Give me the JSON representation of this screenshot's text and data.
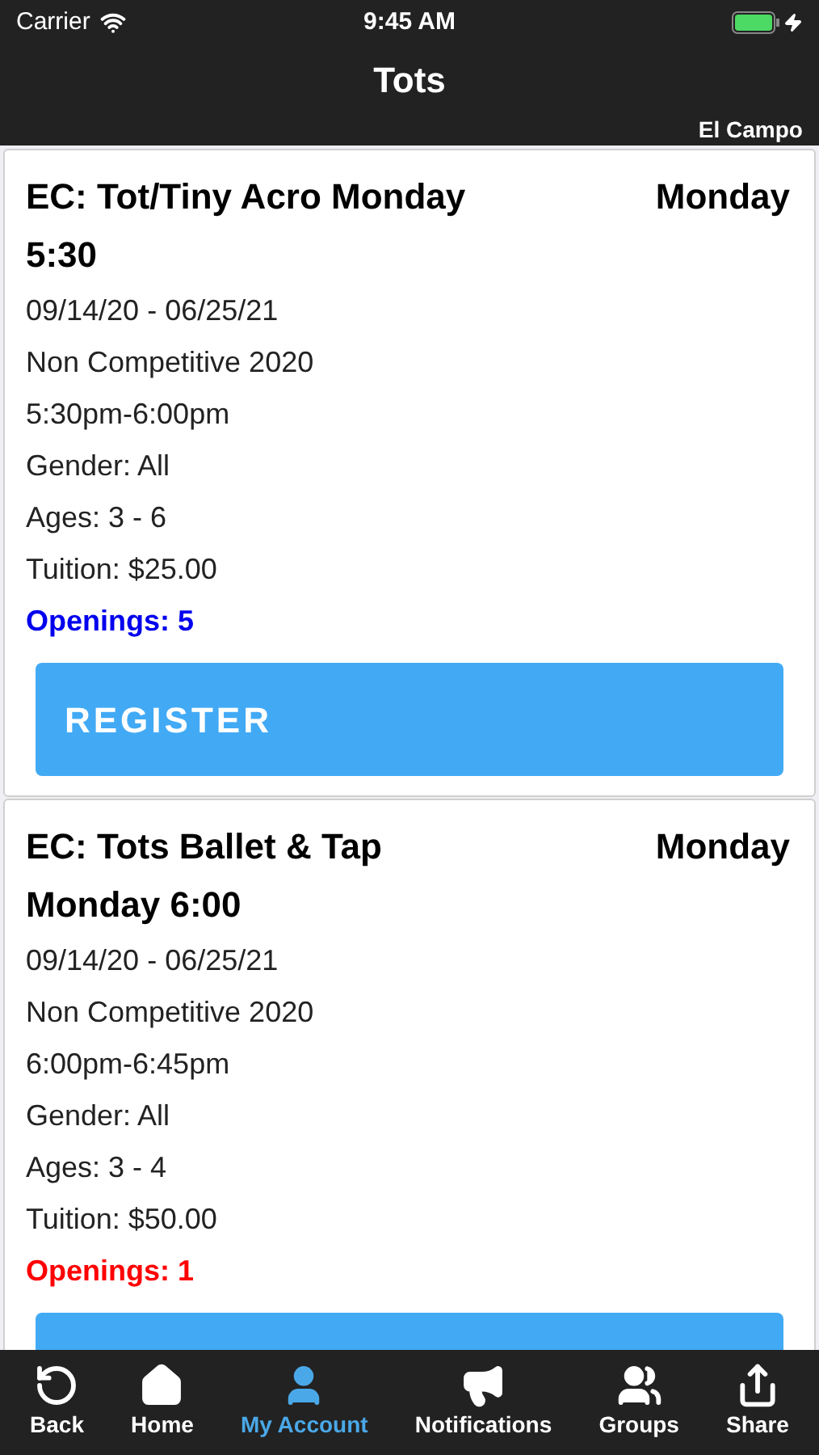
{
  "status_bar": {
    "carrier": "Carrier",
    "time": "9:45 AM"
  },
  "nav": {
    "title": "Tots",
    "location": "El Campo"
  },
  "classes": [
    {
      "name": "EC: Tot/Tiny Acro Monday 5:30",
      "day": "Monday",
      "details": [
        "09/14/20 - 06/25/21",
        "Non Competitive 2020",
        "5:30pm-6:00pm",
        "Gender: All",
        "Ages: 3 - 6",
        "Tuition: $25.00"
      ],
      "openings": "Openings: 5",
      "color": "#0000ee",
      "button": "REGISTER"
    },
    {
      "name": "EC: Tots Ballet & Tap Monday 6:00",
      "day": "Monday",
      "details": [
        "09/14/20 - 06/25/21",
        "Non Competitive 2020",
        "6:00pm-6:45pm",
        "Gender: All",
        "Ages: 3 - 4",
        "Tuition: $50.00"
      ],
      "openings": "Openings: 1",
      "color": "#ff0000"
    }
  ],
  "tab_bar": [
    {
      "label": "Back",
      "selected": false
    },
    {
      "label": "Home",
      "selected": false
    },
    {
      "label": "My Account",
      "selected": true
    },
    {
      "label": "Notifications",
      "selected": false
    },
    {
      "label": "Groups",
      "selected": false
    },
    {
      "label": "Share",
      "selected": false
    }
  ]
}
